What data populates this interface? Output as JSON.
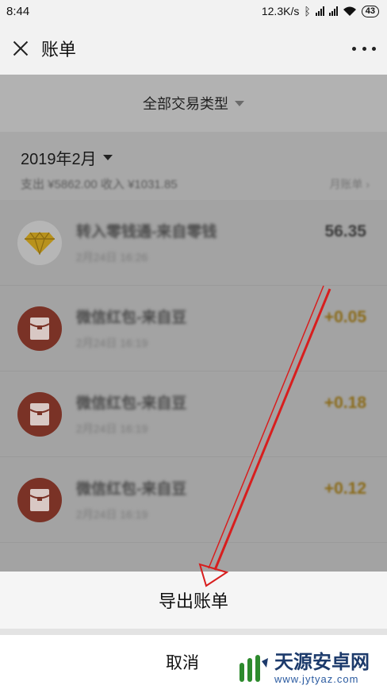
{
  "status_bar": {
    "time": "8:44",
    "network_speed": "12.3K/s",
    "battery": "43"
  },
  "header": {
    "title": "账单"
  },
  "filter": {
    "label": "全部交易类型"
  },
  "month": {
    "label": "2019年2月",
    "summary": "支出 ¥5862.00 收入 ¥1031.85",
    "monthly_link": "月账单 ›"
  },
  "transactions": [
    {
      "title": "转入零钱通-来自零钱",
      "time": "2月24日 16:26",
      "amount": "56.35",
      "icon": "diamond-icon"
    },
    {
      "title": "微信红包-来自豆",
      "time": "2月24日 16:19",
      "amount": "+0.05",
      "icon": "red-packet-icon"
    },
    {
      "title": "微信红包-来自豆",
      "time": "2月24日 16:19",
      "amount": "+0.18",
      "icon": "red-packet-icon"
    },
    {
      "title": "微信红包-来自豆",
      "time": "2月24日 16:19",
      "amount": "+0.12",
      "icon": "red-packet-icon"
    }
  ],
  "sheet": {
    "export_label": "导出账单",
    "cancel_label": "取消"
  },
  "watermark": {
    "name": "天源安卓网",
    "url": "www.jytyaz.com"
  },
  "colors": {
    "annotation_arrow": "#d81e1e",
    "amount_income": "#8a6a18",
    "red_packet": "#7a3226"
  }
}
